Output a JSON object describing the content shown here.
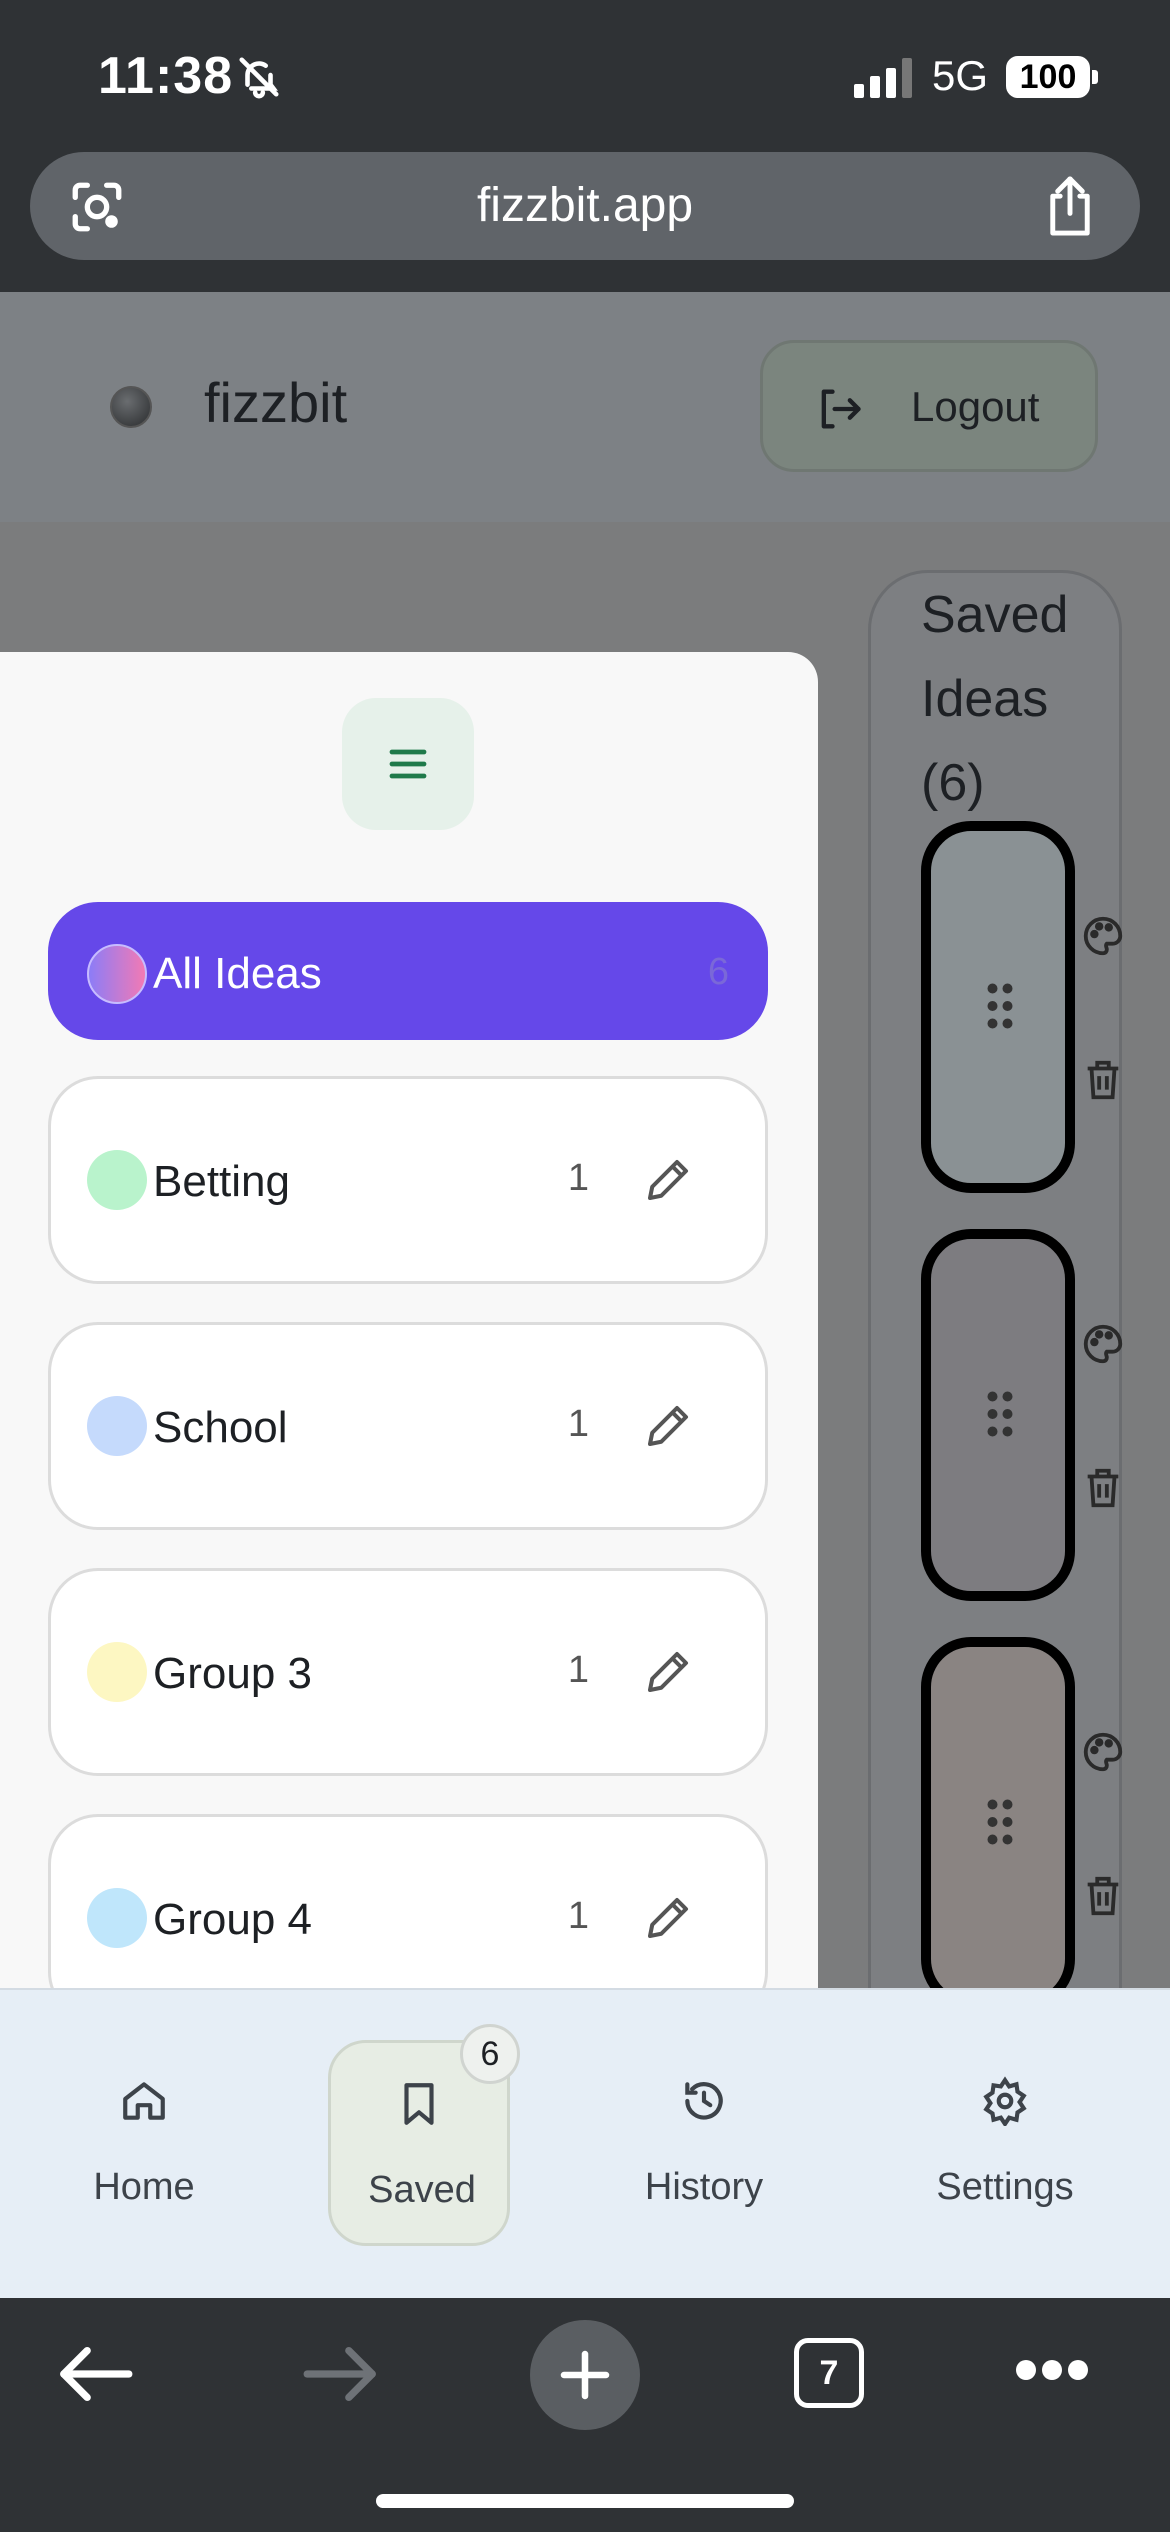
{
  "status_bar": {
    "time": "11:38",
    "network": "5G",
    "battery": "100"
  },
  "browser": {
    "url": "fizzbit.app",
    "tab_count": "7"
  },
  "header": {
    "brand": "fizzbit",
    "logout_label": "Logout"
  },
  "saved_panel": {
    "title": "Saved Ideas (6)",
    "card_colors": [
      "#8a9194",
      "#7d7c80",
      "#8a8482"
    ]
  },
  "groups": [
    {
      "label": "All Ideas",
      "count": "6",
      "active": true,
      "color": "gradient"
    },
    {
      "label": "Betting",
      "count": "1",
      "color": "#b9f3cc"
    },
    {
      "label": "School",
      "count": "1",
      "color": "#c5dafc"
    },
    {
      "label": "Group 3",
      "count": "1",
      "color": "#fdf7c2"
    },
    {
      "label": "Group 4",
      "count": "1",
      "color": "#bfe6fb"
    }
  ],
  "bottom_nav": {
    "items": [
      {
        "label": "Home",
        "icon": "home-icon"
      },
      {
        "label": "Saved",
        "icon": "bookmark-icon",
        "badge": "6",
        "active": true
      },
      {
        "label": "History",
        "icon": "history-icon"
      },
      {
        "label": "Settings",
        "icon": "gear-icon"
      }
    ]
  },
  "colors": {
    "accent": "#6548e9",
    "nav_bg": "#e6eef6",
    "browser_chrome": "#2f3235"
  }
}
